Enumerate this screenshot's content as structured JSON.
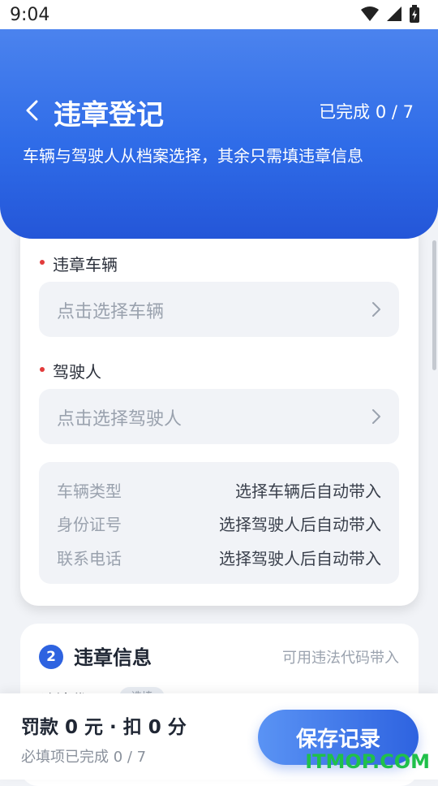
{
  "status_bar": {
    "time": "9:04",
    "icons": [
      "wifi-icon",
      "signal-icon",
      "battery-icon"
    ]
  },
  "header": {
    "title": "违章登记",
    "progress": "已完成 0 / 7",
    "subtitle": "车辆与驾驶人从档案选择，其余只需填违章信息",
    "back_icon": "chevron-left-icon"
  },
  "vehicle_section": {
    "vehicle_label": "违章车辆",
    "vehicle_placeholder": "点击选择车辆",
    "driver_label": "驾驶人",
    "driver_placeholder": "点击选择驾驶人",
    "info_rows": [
      {
        "key": "车辆类型",
        "value": "选择车辆后自动带入"
      },
      {
        "key": "身份证号",
        "value": "选择驾驶人后自动带入"
      },
      {
        "key": "联系电话",
        "value": "选择驾驶人后自动带入"
      }
    ]
  },
  "violation_section": {
    "step": "2",
    "title": "违章信息",
    "hint": "可用违法代码带入",
    "peek_label": "违法代码",
    "peek_chip": "选填"
  },
  "bottom_bar": {
    "summary": "罚款 0 元 · 扣 0 分",
    "required_status": "必填项已完成 0 / 7",
    "save_label": "保存记录"
  },
  "watermark": "ITMOP.COM",
  "colors": {
    "brand": "#2e63e0",
    "required_dot": "#e23b3b",
    "watermark": "#20c04a"
  }
}
